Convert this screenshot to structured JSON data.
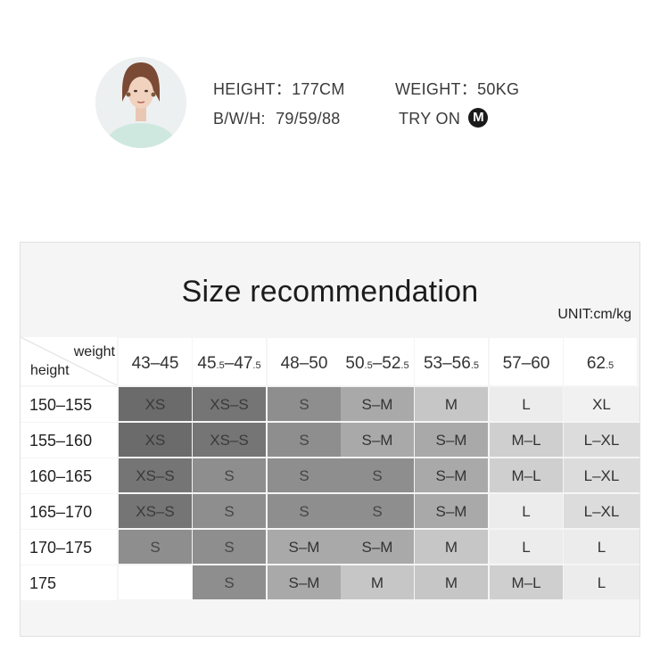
{
  "model": {
    "height_label": "HEIGHT：",
    "height_value": "177CM",
    "weight_label": "WEIGHT：",
    "weight_value": "50KG",
    "bwh_label": "B/W/H:",
    "bwh_value": "79/59/88",
    "try_on_label": "TRY ON",
    "try_on_size": "M"
  },
  "table": {
    "title": "Size recommendation",
    "unit": "UNIT:cm/kg",
    "corner_weight": "weight",
    "corner_height": "height",
    "weight_columns": [
      {
        "main": "43–45",
        "parts": [
          [
            "43–45",
            ""
          ]
        ]
      },
      {
        "main": "45.5–47.5",
        "parts": [
          [
            "45",
            ".5"
          ],
          [
            "–47",
            ".5"
          ]
        ]
      },
      {
        "main": "48–50",
        "parts": [
          [
            "48–50",
            ""
          ]
        ]
      },
      {
        "main": "50.5–52.5",
        "parts": [
          [
            "50",
            ".5"
          ],
          [
            "–52",
            ".5"
          ]
        ]
      },
      {
        "main": "53–56.5",
        "parts": [
          [
            "53–56",
            ".5"
          ]
        ]
      },
      {
        "main": "57–60",
        "parts": [
          [
            "57–60",
            ""
          ]
        ]
      },
      {
        "main": "62.5",
        "parts": [
          [
            "62",
            ".5"
          ]
        ]
      }
    ],
    "rows": [
      {
        "height": "150–155",
        "sizes": [
          "XS",
          "XS–S",
          "S",
          "S–M",
          "M",
          "L",
          "XL"
        ]
      },
      {
        "height": "155–160",
        "sizes": [
          "XS",
          "XS–S",
          "S",
          "S–M",
          "S–M",
          "M–L",
          "L–XL"
        ]
      },
      {
        "height": "160–165",
        "sizes": [
          "XS–S",
          "S",
          "S",
          "S",
          "S–M",
          "M–L",
          "L–XL"
        ]
      },
      {
        "height": "165–170",
        "sizes": [
          "XS–S",
          "S",
          "S",
          "S",
          "S–M",
          "L",
          "L–XL"
        ]
      },
      {
        "height": "170–175",
        "sizes": [
          "S",
          "S",
          "S–M",
          "S–M",
          "M",
          "L",
          "L"
        ]
      },
      {
        "height": "175",
        "sizes": [
          "",
          "S",
          "S–M",
          "M",
          "M",
          "M–L",
          "L"
        ]
      }
    ],
    "size_colors": {
      "XS": "#6b6b6b",
      "XS–S": "#757575",
      "S": "#8e8e8e",
      "S–M": "#a9a9a9",
      "M": "#c6c6c6",
      "M–L": "#cfcfcf",
      "L": "#ececec",
      "L–XL": "#dcdcdc",
      "XL": "#f1f1f1",
      "": "#ffffff"
    },
    "size_text_colors": {
      "XS": "#3a3a3a",
      "XS–S": "#3a3a3a",
      "S": "#454545",
      "S–M": "#333333",
      "M": "#333333",
      "M–L": "#333333",
      "L": "#333333",
      "L–XL": "#333333",
      "XL": "#333333",
      "": "#333333"
    }
  }
}
